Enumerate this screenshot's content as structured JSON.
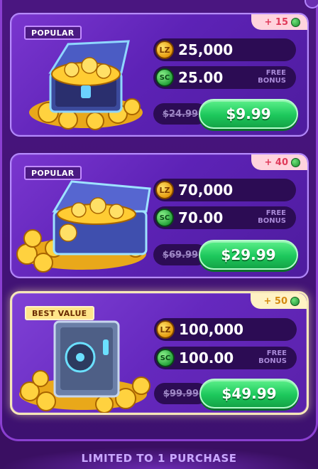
{
  "offers": [
    {
      "tag": "POPULAR",
      "bonus": "+ 15",
      "gold_coins": "25,000",
      "sweeps_coins": "25.00",
      "free_bonus_line1": "FREE",
      "free_bonus_line2": "BONUS",
      "original_price": "$24.99",
      "price": "$9.99",
      "art": "treasure-chest"
    },
    {
      "tag": "POPULAR",
      "bonus": "+ 40",
      "gold_coins": "70,000",
      "sweeps_coins": "70.00",
      "free_bonus_line1": "FREE",
      "free_bonus_line2": "BONUS",
      "original_price": "$69.99",
      "price": "$29.99",
      "art": "coin-case"
    },
    {
      "tag": "BEST VALUE",
      "bonus": "+ 50",
      "gold_coins": "100,000",
      "sweeps_coins": "100.00",
      "free_bonus_line1": "FREE",
      "free_bonus_line2": "BONUS",
      "original_price": "$99.99",
      "price": "$49.99",
      "art": "vault-safe"
    }
  ],
  "footer_text": "LIMITED TO 1 PURCHASE",
  "gold_coin_glyph": "LZ",
  "sweeps_coin_glyph": "SC",
  "colors": {
    "buy_button": "#1dc85c",
    "card_bg": "#5d22b6",
    "best_value_border": "#f6e7b8",
    "popular_bonus_tab": "#ffd3dd",
    "best_value_bonus_tab": "#fff2c4"
  }
}
